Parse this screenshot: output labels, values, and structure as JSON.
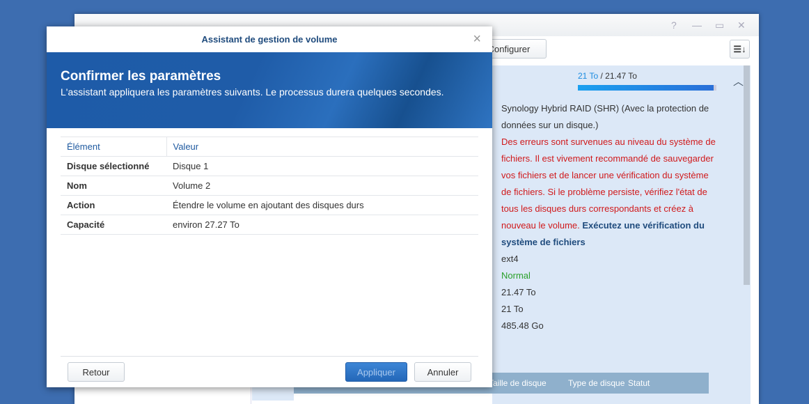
{
  "background_window": {
    "toolbar": {
      "configure_label": "Configurer"
    },
    "usage": {
      "used": "21 To",
      "total": " / 21.47 To",
      "percent": 97.8
    },
    "details": {
      "raid": "Synology Hybrid RAID (SHR) (Avec la protection de données sur un disque.)",
      "error": "Des erreurs sont survenues au niveau du système de fichiers. Il est vivement recommandé de sauvegarder vos fichiers et de lancer une vérification du système de fichiers. Si le problème persiste, vérifiez l'état de tous les disques durs correspondants et créez à nouveau le volume.",
      "error_link": "Exécutez une vérification du système de fichiers",
      "filesystem": "ext4",
      "status": "Normal",
      "capacity": "21.47 To",
      "used": "21 To",
      "free": "485.48 Go"
    },
    "disk_table_headers": [
      "Taille de disque",
      "Type de disque",
      "Statut"
    ]
  },
  "dialog": {
    "title": "Assistant de gestion de volume",
    "heading": "Confirmer les paramètres",
    "description": "L'assistant appliquera les paramètres suivants. Le processus durera quelques secondes.",
    "columns": [
      "Élément",
      "Valeur"
    ],
    "rows": [
      {
        "k": "Disque sélectionné",
        "v": "Disque 1"
      },
      {
        "k": "Nom",
        "v": "Volume 2"
      },
      {
        "k": "Action",
        "v": "Étendre le volume en ajoutant des disques durs"
      },
      {
        "k": "Capacité",
        "v": "environ 27.27 To"
      }
    ],
    "back_label": "Retour",
    "apply_label": "Appliquer",
    "cancel_label": "Annuler"
  }
}
